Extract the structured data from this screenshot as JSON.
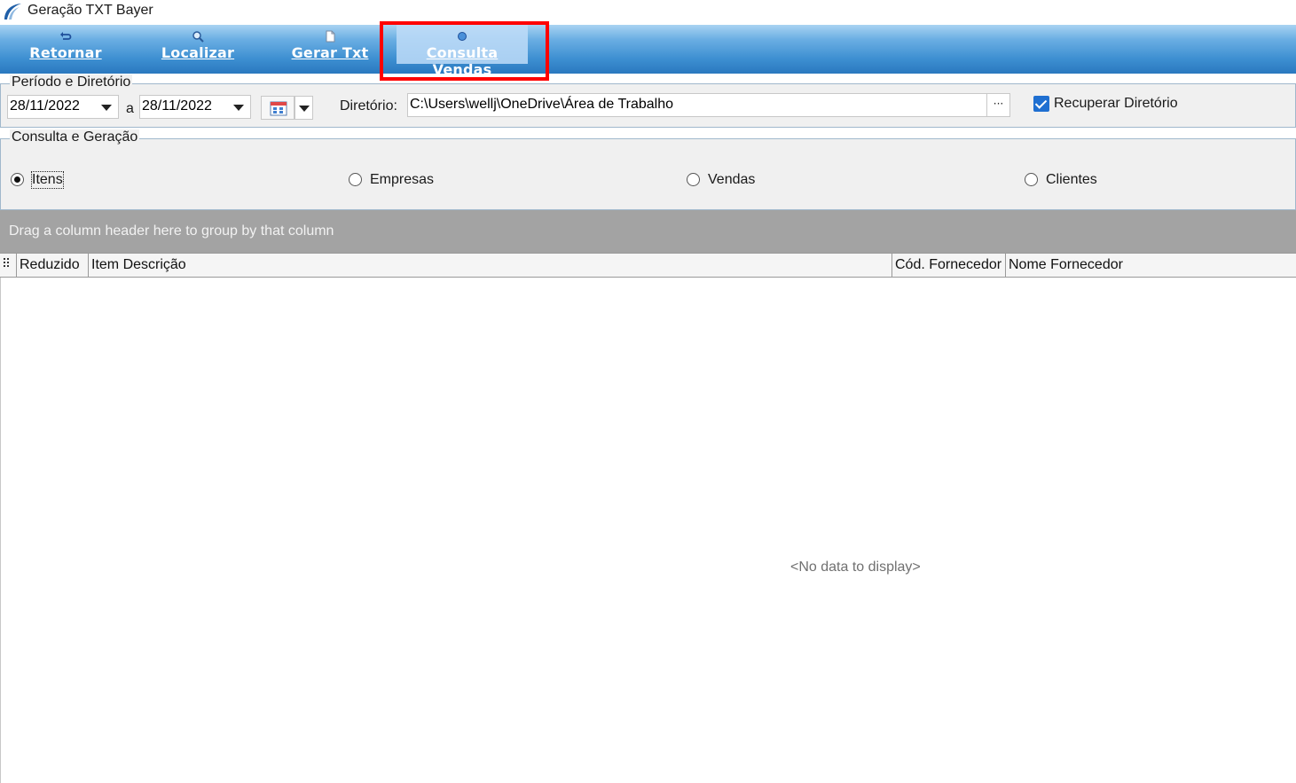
{
  "window": {
    "title": "Geração TXT Bayer"
  },
  "toolbar": {
    "buttons": [
      {
        "label": "Retornar",
        "icon": "undo-arrow-icon"
      },
      {
        "label": "Localizar",
        "icon": "magnifier-icon"
      },
      {
        "label": "Gerar Txt",
        "icon": "document-icon"
      },
      {
        "label": "Consulta Vendas",
        "icon": "circle-icon",
        "active": true
      }
    ]
  },
  "periodo": {
    "group_title": "Período e Diretório",
    "date_from": "28/11/2022",
    "separator": "a",
    "date_to": "28/11/2022",
    "dir_label": "Diretório:",
    "dir_value": "C:\\Users\\wellj\\OneDrive\\Área de Trabalho",
    "browse_label": "···",
    "recuperar_label": "Recuperar Diretório",
    "recuperar_checked": true
  },
  "consulta": {
    "group_title": "Consulta e Geração",
    "options": [
      {
        "label": "Itens",
        "checked": true
      },
      {
        "label": "Empresas",
        "checked": false
      },
      {
        "label": "Vendas",
        "checked": false
      },
      {
        "label": "Clientes",
        "checked": false
      }
    ]
  },
  "grid": {
    "group_panel_text": "Drag a column header here to group by that column",
    "columns": [
      "Reduzido",
      "Item Descrição",
      "Cód. Fornecedor",
      "Nome Fornecedor"
    ],
    "empty_text": "<No data to display>"
  },
  "colors": {
    "toolbar_top": "#a9d3f2",
    "toolbar_bottom": "#2a78bf",
    "highlight": "#ff0000",
    "checkbox": "#1f6fd1"
  }
}
